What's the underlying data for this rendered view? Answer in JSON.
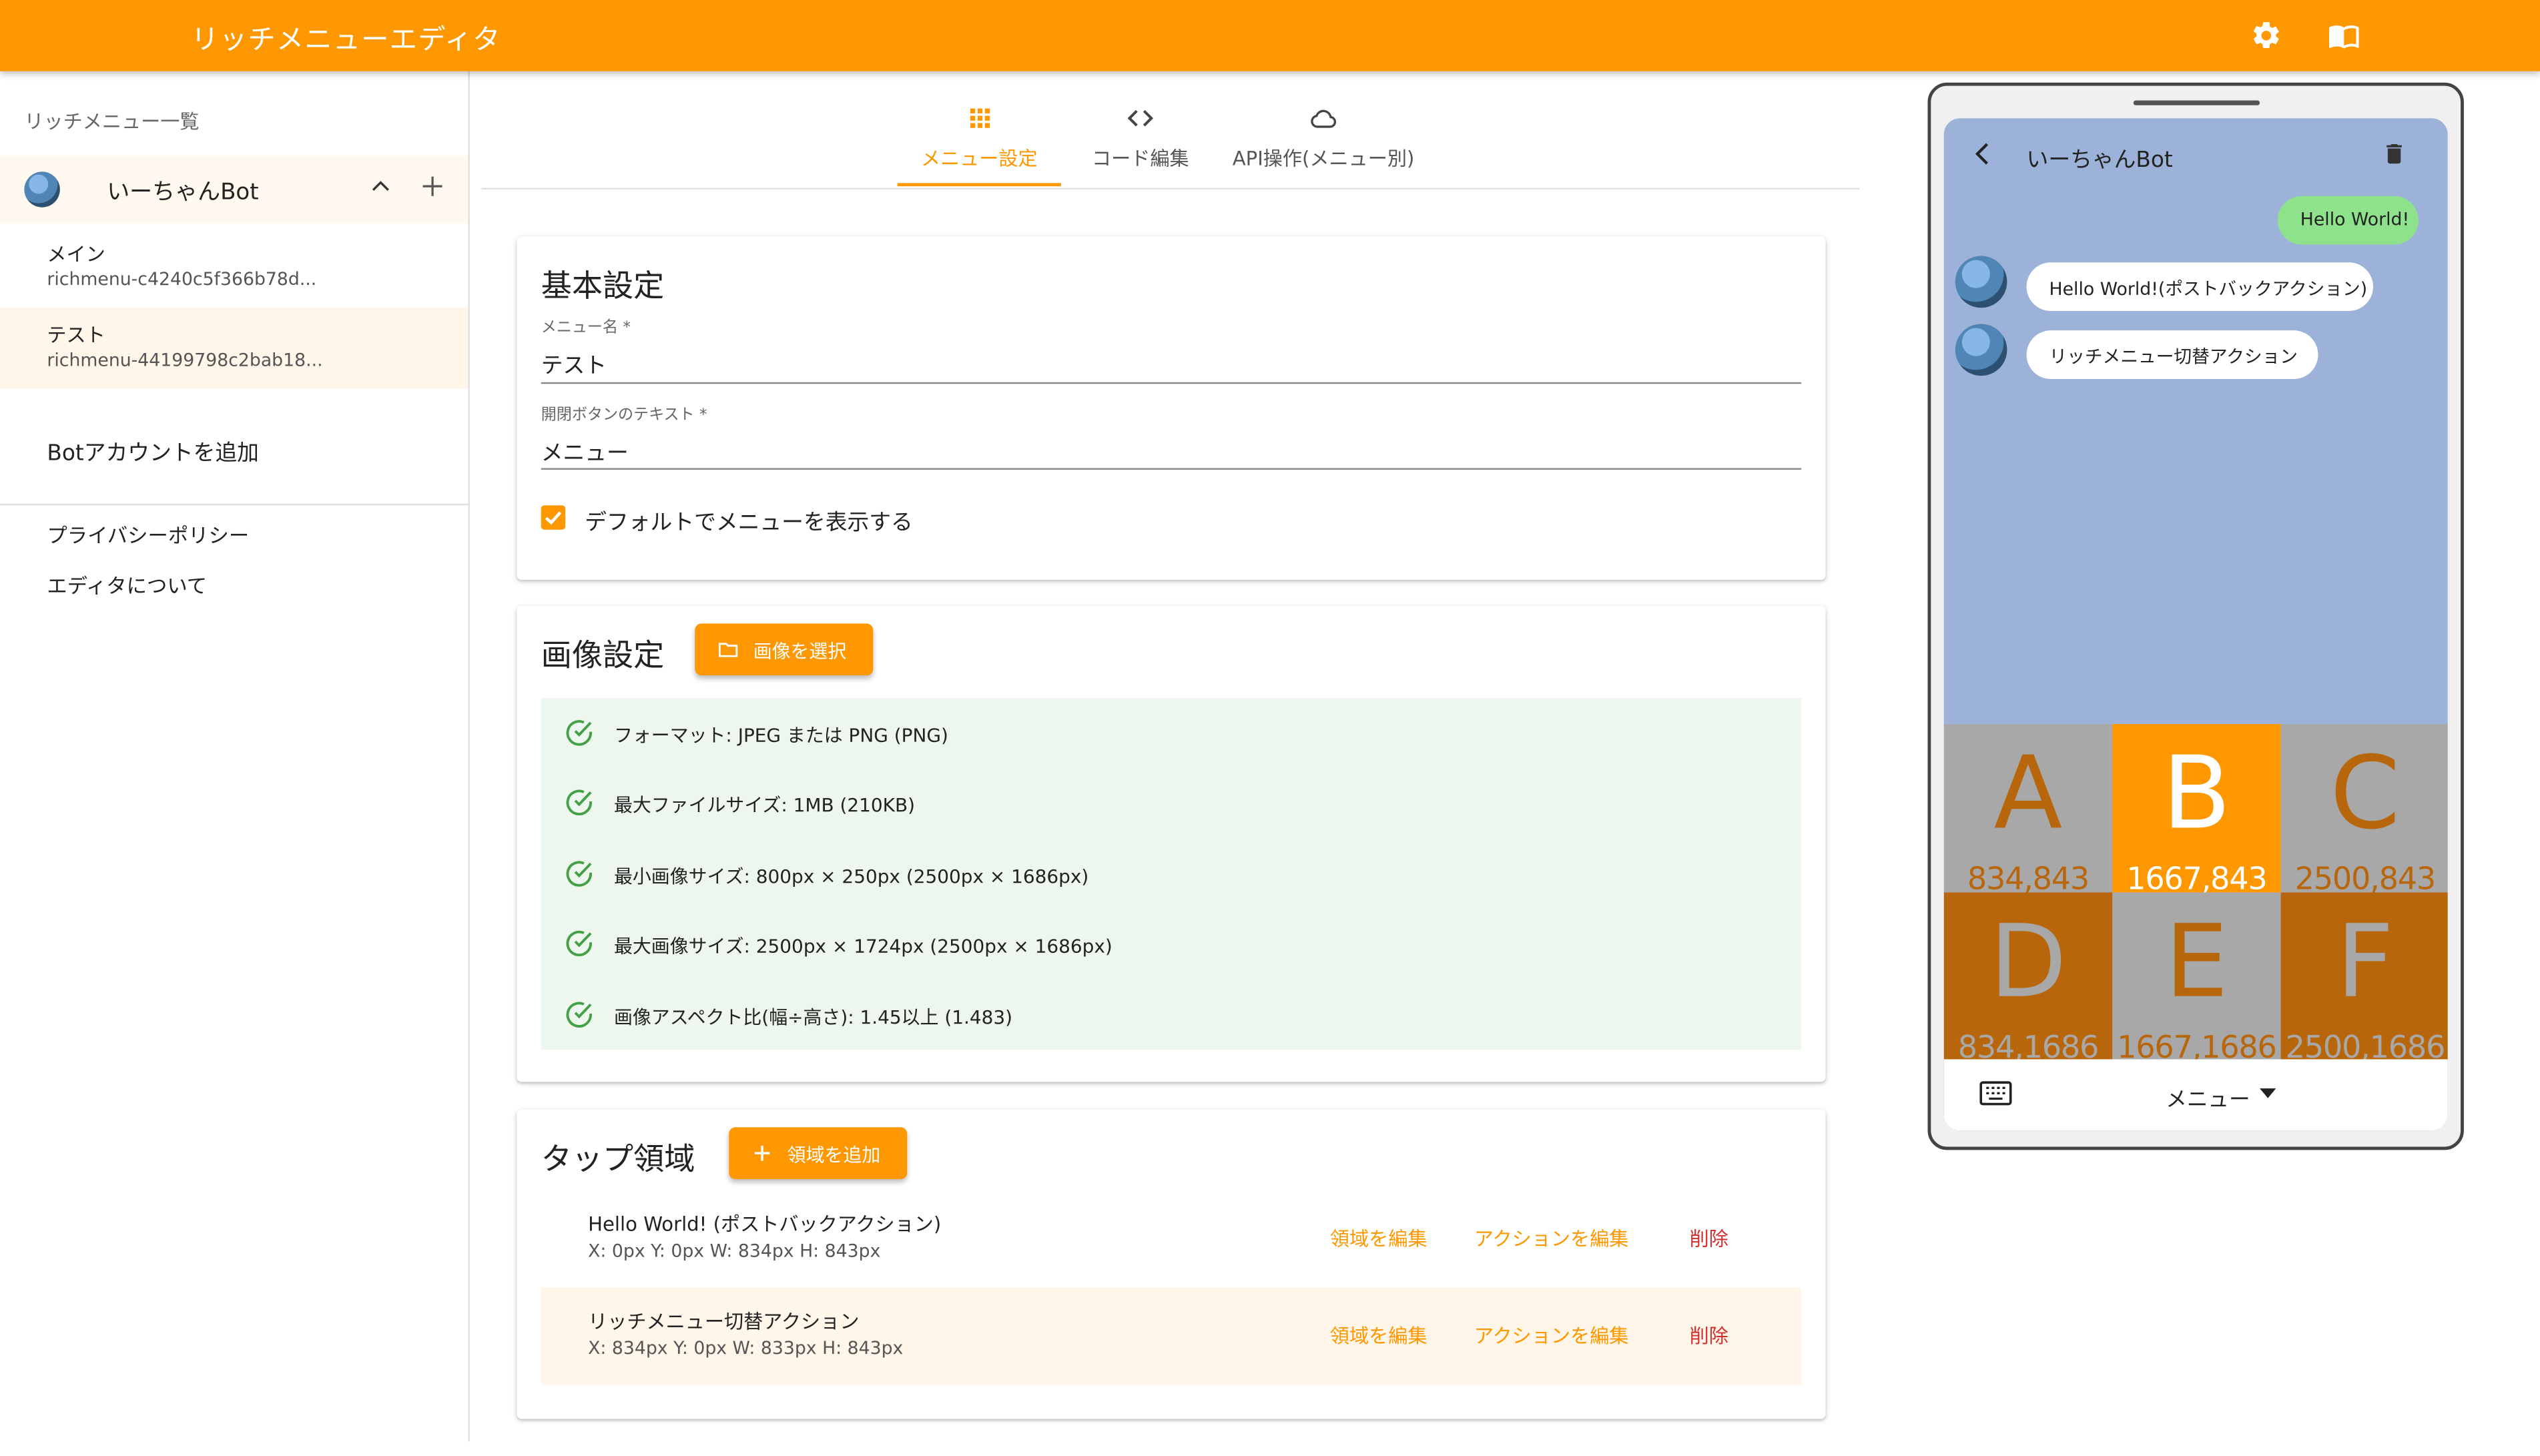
{
  "app": {
    "title": "リッチメニューエディタ"
  },
  "sidebar": {
    "subheader": "リッチメニュー一覧",
    "bot_name": "いーちゃんBot",
    "menus": [
      {
        "name": "メイン",
        "id": "richmenu-c4240c5f366b78d..."
      },
      {
        "name": "テスト",
        "id": "richmenu-44199798c2bab18...",
        "active": true
      }
    ],
    "add_bot": "Botアカウントを追加",
    "links": [
      "プライバシーポリシー",
      "エディタについて"
    ]
  },
  "tabs": [
    {
      "label": "メニュー設定",
      "icon": "grid-icon",
      "active": true
    },
    {
      "label": "コード編集",
      "icon": "code-icon"
    },
    {
      "label": "API操作(メニュー別)",
      "icon": "cloud-icon"
    }
  ],
  "basic": {
    "title": "基本設定",
    "name_label": "メニュー名 *",
    "name_value": "テスト",
    "chat_label": "開閉ボタンのテキスト *",
    "chat_value": "メニュー",
    "default_label": "デフォルトでメニューを表示する",
    "default_checked": true
  },
  "image": {
    "title": "画像設定",
    "select_button": "画像を選択",
    "checks": [
      "フォーマット: JPEG または PNG (PNG)",
      "最大ファイルサイズ: 1MB (210KB)",
      "最小画像サイズ: 800px × 250px (2500px × 1686px)",
      "最大画像サイズ: 2500px × 1724px (2500px × 1686px)",
      "画像アスペクト比(幅÷高さ): 1.45以上 (1.483)"
    ]
  },
  "areas": {
    "title": "タップ領域",
    "add_button": "領域を追加",
    "edit_area": "領域を編集",
    "edit_action": "アクションを編集",
    "delete": "削除",
    "rows": [
      {
        "name": "Hello World! (ポストバックアクション)",
        "geometry": "X: 0px Y: 0px W: 834px H: 843px"
      },
      {
        "name": "リッチメニュー切替アクション",
        "geometry": "X: 834px Y: 0px W: 833px H: 843px"
      }
    ]
  },
  "preview": {
    "bot_name": "いーちゃんBot",
    "user_message": "Hello World!",
    "bot_messages": [
      "Hello World!(ポストバックアクション)",
      "リッチメニュー切替アクション"
    ],
    "cells": [
      {
        "letter": "A",
        "coord": "834,843",
        "bg": "#a8a8a8",
        "fg": "#b8660b"
      },
      {
        "letter": "B",
        "coord": "1667,843",
        "bg": "#ff9800",
        "fg": "#ffffff"
      },
      {
        "letter": "C",
        "coord": "2500,843",
        "bg": "#a8a8a8",
        "fg": "#b8660b"
      },
      {
        "letter": "D",
        "coord": "834,1686",
        "bg": "#b8660b",
        "fg": "#a8a8a8"
      },
      {
        "letter": "E",
        "coord": "1667,1686",
        "bg": "#a8a8a8",
        "fg": "#b8660b"
      },
      {
        "letter": "F",
        "coord": "2500,1686",
        "bg": "#b8660b",
        "fg": "#a8a8a8"
      }
    ],
    "footer_label": "メニュー"
  },
  "colors": {
    "accent": "#ff9800",
    "danger": "#d32f2f",
    "success": "#43a047",
    "chat_bg": "#9cb2d9"
  }
}
